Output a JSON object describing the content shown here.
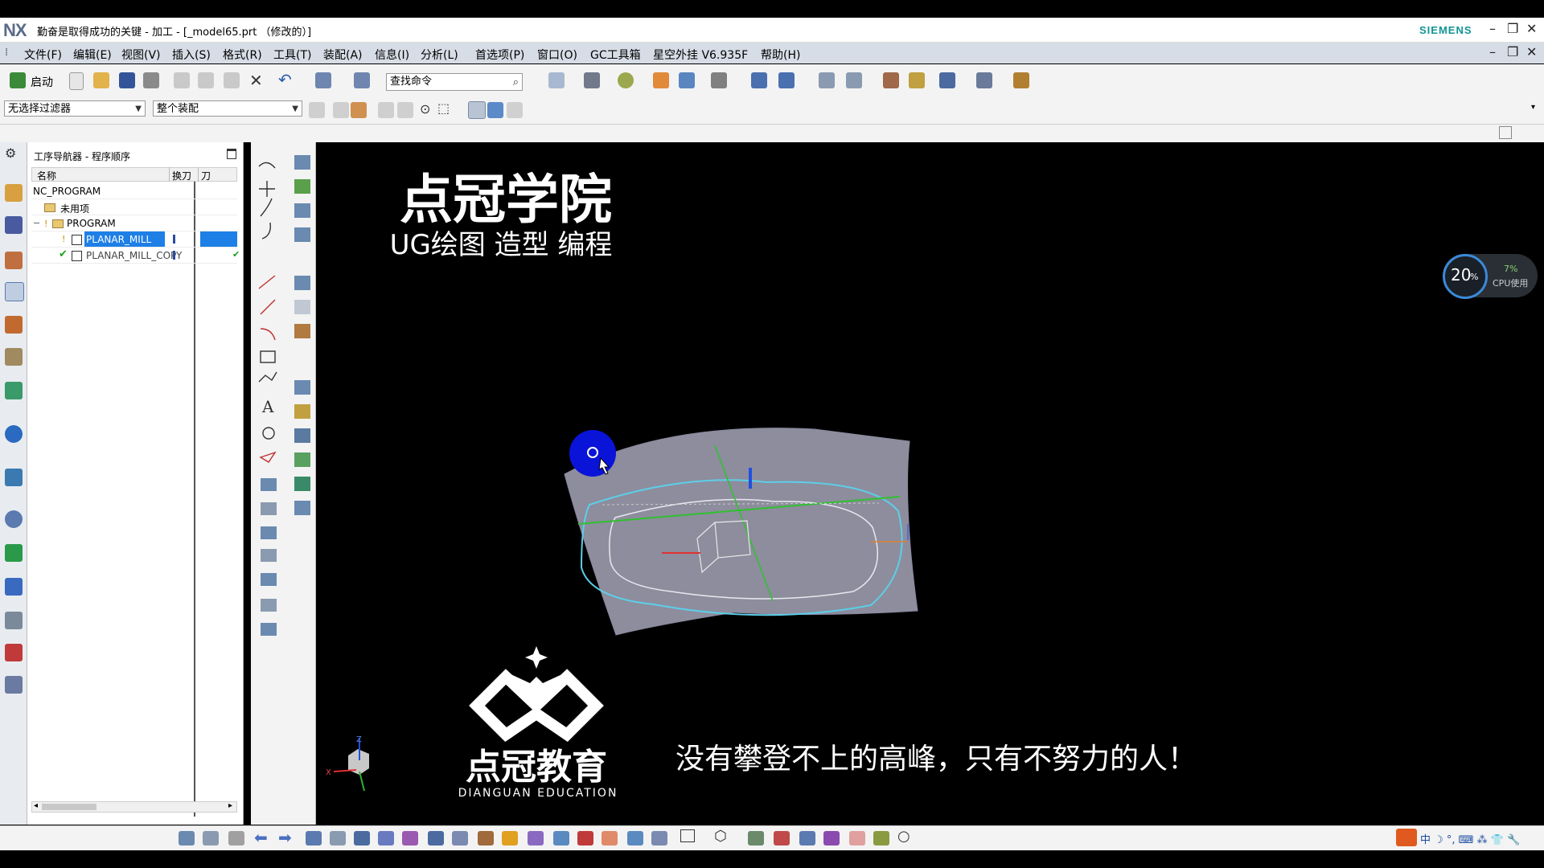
{
  "window": {
    "logo": "NX",
    "title": "勤奋是取得成功的关键 - 加工 - [_model65.prt （修改的）]",
    "brand": "SIEMENS",
    "min": "–",
    "restore": "❐",
    "close": "✕"
  },
  "menubar": {
    "items": [
      "文件(F)",
      "编辑(E)",
      "视图(V)",
      "插入(S)",
      "格式(R)",
      "工具(T)",
      "装配(A)",
      "信息(I)",
      "分析(L)",
      "首选项(P)",
      "窗口(O)",
      "GC工具箱",
      "星空外挂 V6.935F",
      "帮助(H)"
    ]
  },
  "toolbar": {
    "start_label": "启动",
    "search_placeholder": "查找命令"
  },
  "filters": {
    "selection_filter": "无选择过滤器",
    "assembly_scope": "整个装配"
  },
  "navigator": {
    "title": "工序导航器 - 程序顺序",
    "columns": [
      "名称",
      "换刀",
      "刀"
    ],
    "rows": [
      {
        "name": "NC_PROGRAM",
        "level": 0
      },
      {
        "name": "未用项",
        "level": 1
      },
      {
        "name": "PROGRAM",
        "level": 1
      },
      {
        "name": "PLANAR_MILL",
        "level": 2,
        "selected": true
      },
      {
        "name": "PLANAR_MILL_COPY",
        "level": 2
      }
    ]
  },
  "overlay": {
    "brand_title": "点冠学院",
    "brand_subtitle": "UG绘图 造型 编程",
    "edu_cn": "点冠教育",
    "edu_en": "DIANGUAN EDUCATION",
    "slogan": "没有攀登不上的高峰，只有不努力的人！"
  },
  "cpu": {
    "main_percent": "20",
    "pct_sign": "%",
    "usage": "7%",
    "label": "CPU使用"
  },
  "axes": {
    "x": "X",
    "z": "Z"
  },
  "colors": {
    "menubar_bg": "#d6dde6",
    "selection_blue": "#1e7fe6",
    "surface": "#a6a6b8",
    "toolpath": "#5ccfe8",
    "cursor_blue": "#0a14d8"
  }
}
